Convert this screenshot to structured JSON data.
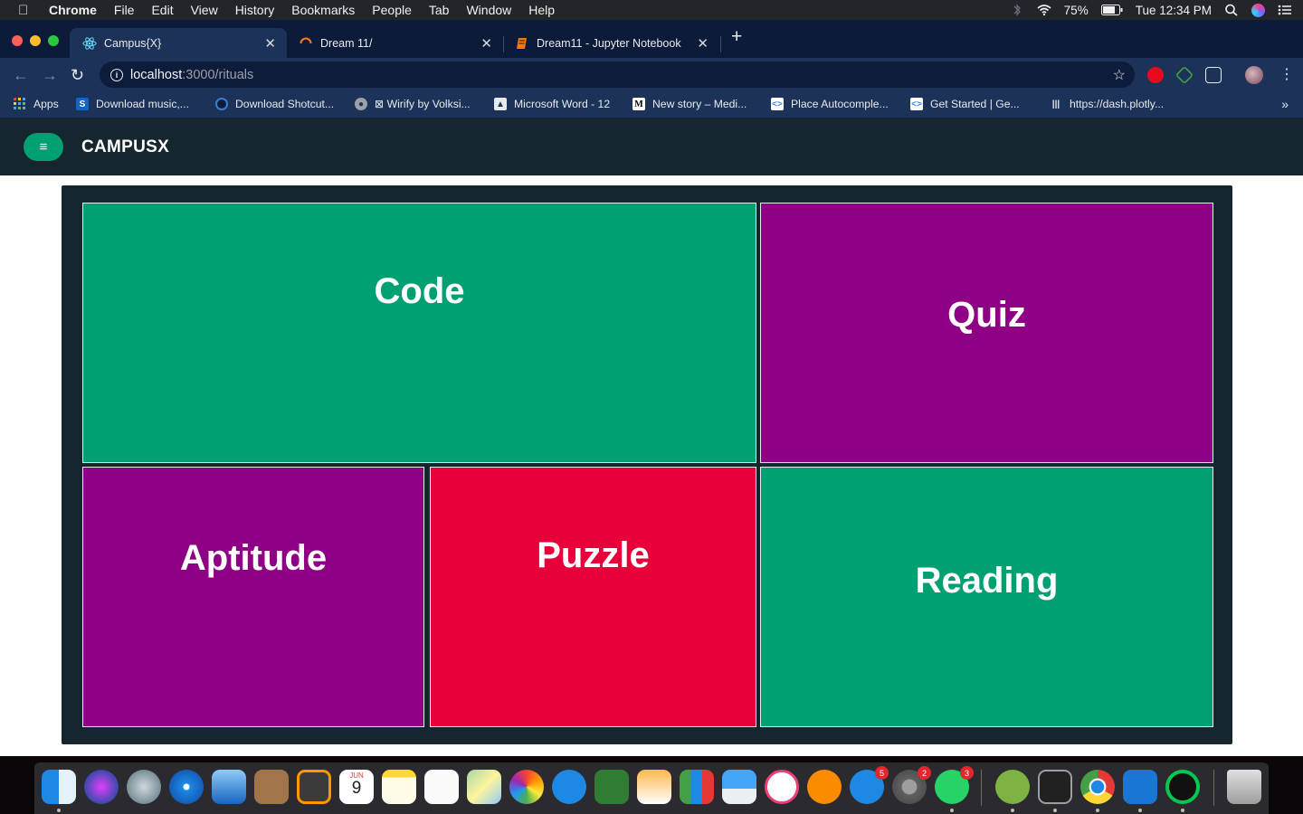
{
  "menubar": {
    "app_name": "Chrome",
    "items": [
      "File",
      "Edit",
      "View",
      "History",
      "Bookmarks",
      "People",
      "Tab",
      "Window",
      "Help"
    ],
    "battery": "75%",
    "clock": "Tue 12:34 PM"
  },
  "tabs": [
    {
      "title": "Campus{X}",
      "icon": "react-icon",
      "active": true
    },
    {
      "title": "Dream 11/",
      "icon": "loading-icon",
      "active": false
    },
    {
      "title": "Dream11 - Jupyter Notebook",
      "icon": "notebook-icon",
      "active": false
    }
  ],
  "address_bar": {
    "host": "localhost",
    "path": ":3000/rituals"
  },
  "bookmarks": [
    {
      "label": "Apps",
      "icon": "apps-grid-icon"
    },
    {
      "label": "Download music,...",
      "icon": "site-icon"
    },
    {
      "label": "Download Shotcut...",
      "icon": "site-icon"
    },
    {
      "label": "⊠ Wirify by Volksi...",
      "icon": "globe-icon"
    },
    {
      "label": "Microsoft Word - 12",
      "icon": "site-icon"
    },
    {
      "label": "New story – Medi...",
      "icon": "medium-icon"
    },
    {
      "label": "Place Autocomple...",
      "icon": "site-icon"
    },
    {
      "label": "Get Started  |  Ge...",
      "icon": "site-icon"
    },
    {
      "label": "https://dash.plotly...",
      "icon": "plotly-icon"
    }
  ],
  "app": {
    "brand": "CAMPUSX",
    "menu_icon": "≡",
    "tiles": [
      {
        "label": "Code",
        "color": "#00a073"
      },
      {
        "label": "Quiz",
        "color": "#8e0084"
      },
      {
        "label": "Aptitude",
        "color": "#8e0084"
      },
      {
        "label": "Puzzle",
        "color": "#e8003a"
      },
      {
        "label": "Reading",
        "color": "#00a073"
      }
    ]
  },
  "dock": {
    "badges": {
      "app_store": "5",
      "system_preferences": "2",
      "whatsapp": "3"
    },
    "calendar_month": "JUN",
    "calendar_day": "9"
  }
}
